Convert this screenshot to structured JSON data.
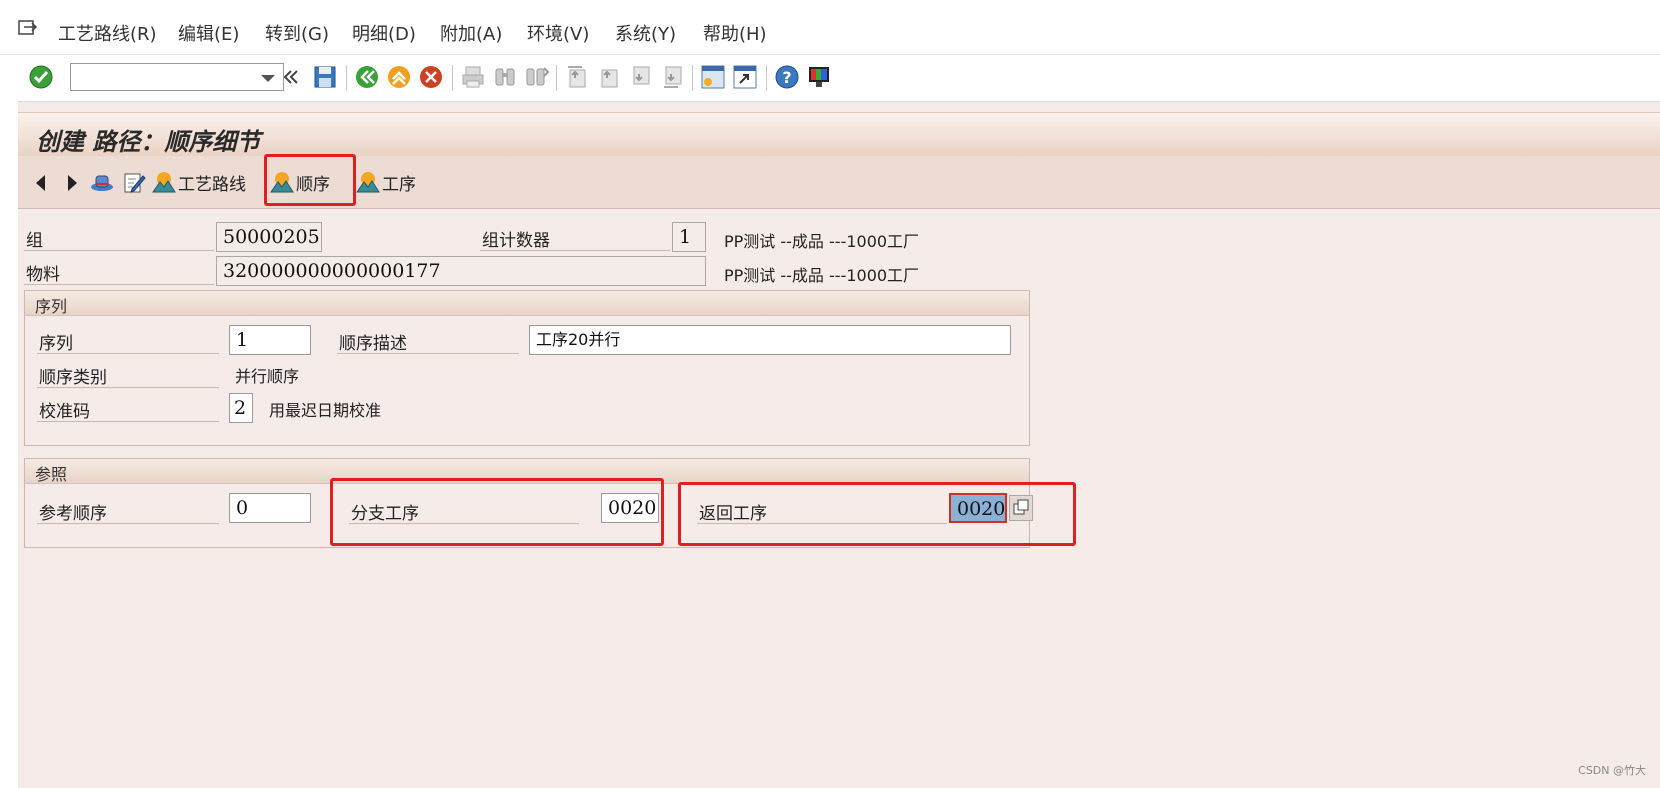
{
  "menu": {
    "items": [
      "工艺路线(R)",
      "编辑(E)",
      "转到(G)",
      "明细(D)",
      "附加(A)",
      "环境(V)",
      "系统(Y)",
      "帮助(H)"
    ]
  },
  "toolbar": {
    "command_field_value": "",
    "icons": [
      "enter-icon",
      "back-double-icon",
      "save-icon",
      "back-icon",
      "exit-icon",
      "cancel-icon",
      "print-icon",
      "find-icon",
      "find-next-icon",
      "first-page-icon",
      "prev-page-icon",
      "next-page-icon",
      "last-page-icon",
      "new-session-icon",
      "shortcut-icon",
      "help-icon",
      "layout-icon"
    ]
  },
  "title": "创建 路径：顺序细节",
  "app_toolbar": {
    "routing_label": "工艺路线",
    "sequence_label": "顺序",
    "operation_label": "工序"
  },
  "header": {
    "group_label": "组",
    "group_value": "50000205",
    "group_counter_label": "组计数器",
    "group_counter_value": "1",
    "group_desc": "PP测试 --成品 ---1000工厂",
    "material_label": "物料",
    "material_value": "320000000000000177",
    "material_desc": "PP测试 --成品 ---1000工厂"
  },
  "sequence_group": {
    "title": "序列",
    "sequence_label": "序列",
    "sequence_value": "1",
    "desc_label": "顺序描述",
    "desc_value": "工序20并行",
    "category_label": "顺序类别",
    "category_value": "并行顺序",
    "alignment_label": "校准码",
    "alignment_value": "2",
    "alignment_text": "用最迟日期校准"
  },
  "reference_group": {
    "title": "参照",
    "ref_seq_label": "参考顺序",
    "ref_seq_value": "0",
    "branch_label": "分支工序",
    "branch_value": "0020",
    "return_label": "返回工序",
    "return_value": "0020"
  },
  "watermark": "CSDN @竹大",
  "colors": {
    "highlight_red": "#e02020",
    "background": "#f5ecea",
    "title_gradient_end": "#e9d2c4"
  }
}
